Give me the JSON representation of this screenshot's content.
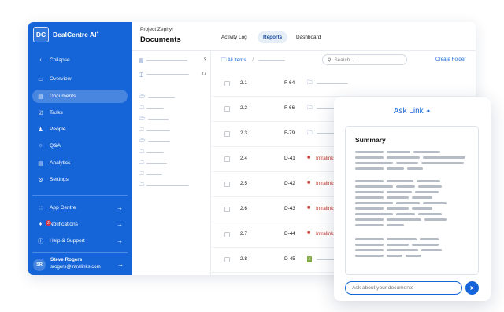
{
  "brand": {
    "logo": "DC",
    "name": "DealCentre AI",
    "superscript": "+"
  },
  "sidebar": {
    "collapse": "Collapse",
    "items": [
      {
        "label": "Overview",
        "icon": "monitor-icon"
      },
      {
        "label": "Documents",
        "icon": "document-icon",
        "active": true
      },
      {
        "label": "Tasks",
        "icon": "checklist-icon"
      },
      {
        "label": "People",
        "icon": "people-icon"
      },
      {
        "label": "Q&A",
        "icon": "chat-icon"
      },
      {
        "label": "Analytics",
        "icon": "analytics-icon"
      },
      {
        "label": "Settings",
        "icon": "gear-icon"
      }
    ],
    "bottom": [
      {
        "label": "App Centre",
        "icon": "grid-icon"
      },
      {
        "label": "Notifications",
        "icon": "bell-icon",
        "badge": "2"
      },
      {
        "label": "Help & Support",
        "icon": "help-icon"
      }
    ],
    "user": {
      "initials": "SR",
      "name": "Steve Rogers",
      "email": "srogers@intralinks.com"
    }
  },
  "header": {
    "project": "Project Zephyr",
    "title": "Documents",
    "tabs": [
      {
        "label": "Activity Log"
      },
      {
        "label": "Reports",
        "active": true
      },
      {
        "label": "Dashboard"
      }
    ]
  },
  "tree": {
    "count_top": "3",
    "count_trash": "17"
  },
  "list": {
    "all_items": "All items",
    "breadcrumb_sep": "/",
    "search_placeholder": "Search...",
    "create_folder": "Create Folder",
    "rows": [
      {
        "num": "2.1",
        "code": "F-64",
        "type": "folder",
        "name": ""
      },
      {
        "num": "2.2",
        "code": "F-66",
        "type": "folder",
        "name": ""
      },
      {
        "num": "2.3",
        "code": "F-79",
        "type": "folder",
        "name": ""
      },
      {
        "num": "2.4",
        "code": "D-41",
        "type": "pdf",
        "name": "Intralinks"
      },
      {
        "num": "2.5",
        "code": "D-42",
        "type": "pdf",
        "name": "Intralinks"
      },
      {
        "num": "2.6",
        "code": "D-43",
        "type": "pdf",
        "name": "Intralinks"
      },
      {
        "num": "2.7",
        "code": "D-44",
        "type": "pdf",
        "name": "Intralinks"
      },
      {
        "num": "2.8",
        "code": "D-45",
        "type": "xls",
        "name": ""
      }
    ]
  },
  "ask": {
    "title": "Ask Link",
    "summary_title": "Summary",
    "input_placeholder": "Ask about your documents"
  },
  "colors": {
    "accent": "#1565d8",
    "pdf": "#d0342c",
    "xls": "#7fa640"
  }
}
